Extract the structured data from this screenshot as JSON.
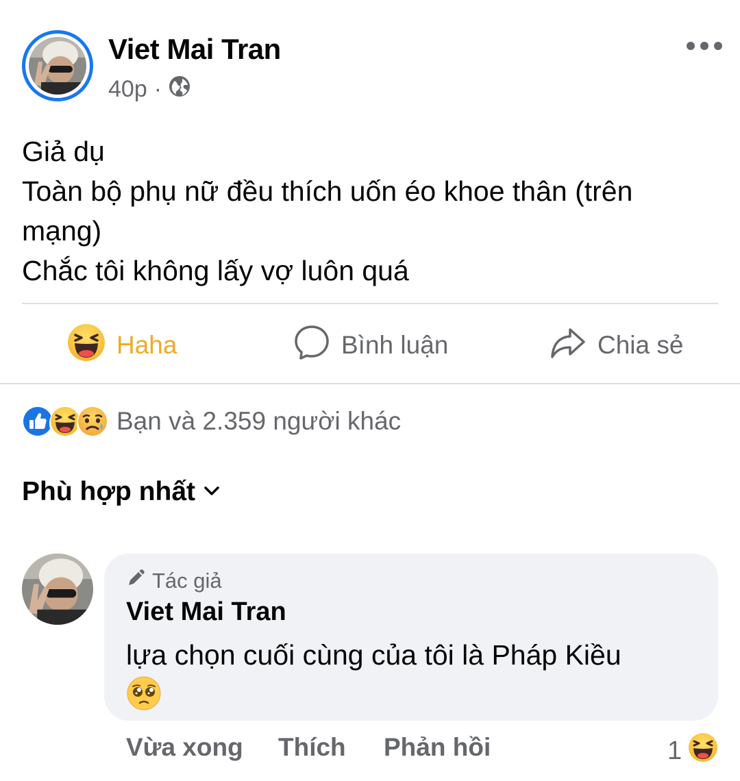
{
  "post": {
    "author": "Viet Mai Tran",
    "time": "40p",
    "separator": "·",
    "privacy_icon": "globe-icon",
    "more_icon": "more-horizontal-icon",
    "lines": [
      "Giả dụ",
      "Toàn bộ phụ nữ đều thích uốn éo khoe thân (trên mạng)",
      "Chắc tôi không lấy vợ luôn quá"
    ]
  },
  "actions": {
    "haha": {
      "label": "Haha",
      "icon": "haha-emoji-icon",
      "color": "#f0a92b"
    },
    "comment": {
      "label": "Bình luận",
      "icon": "comment-icon"
    },
    "share": {
      "label": "Chia sẻ",
      "icon": "share-icon"
    }
  },
  "reactions": {
    "icons": [
      "like-icon",
      "haha-icon",
      "sad-icon"
    ],
    "summary": "Bạn và 2.359 người khác"
  },
  "comments_sort": {
    "label": "Phù hợp nhất",
    "icon": "chevron-down-icon"
  },
  "comment": {
    "badge": "Tác giả",
    "badge_icon": "pencil-icon",
    "author": "Viet Mai Tran",
    "text": "lựa chọn cuối cùng của tôi là Pháp Kiều",
    "emoji": "pleading-face-icon",
    "time": "Vừa xong",
    "like_label": "Thích",
    "reply_label": "Phản hồi",
    "reaction_count": "1",
    "reaction_icon": "haha-icon"
  },
  "colors": {
    "accent": "#1877f2",
    "secondary_text": "#65676b",
    "bubble": "#f0f2f5",
    "haha": "#f0a92b"
  }
}
